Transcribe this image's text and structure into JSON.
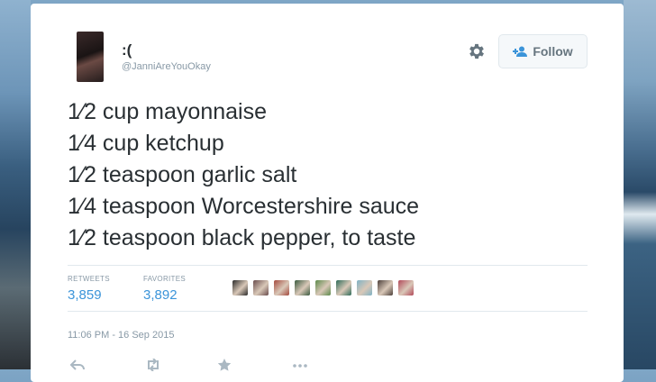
{
  "tweet": {
    "display_name": ":(",
    "handle": "@JanniAreYouOkay",
    "follow_label": "Follow",
    "lines": [
      "1⁄2 cup mayonnaise",
      "1⁄4 cup ketchup",
      "1⁄2 teaspoon garlic salt",
      "1⁄4 teaspoon Worcestershire sauce",
      "1⁄2 teaspoon black pepper, to taste"
    ],
    "stats": {
      "retweets_label": "RETWEETS",
      "retweets": "3,859",
      "favorites_label": "FAVORITES",
      "favorites": "3,892"
    },
    "timestamp": "11:06 PM - 16 Sep 2015",
    "favoriter_colors": [
      "#2b2b2b",
      "#6a4d4d",
      "#a44a3e",
      "#3a5a3f",
      "#5c8a4a",
      "#2e6b58",
      "#7fb2c4",
      "#4c3f3a",
      "#b24a5a"
    ],
    "action_icons": [
      "reply-icon",
      "retweet-icon",
      "favorite-icon",
      "more-icon"
    ]
  },
  "colors": {
    "link": "#3b94d9",
    "muted": "#8899a6",
    "text": "#292f33"
  }
}
